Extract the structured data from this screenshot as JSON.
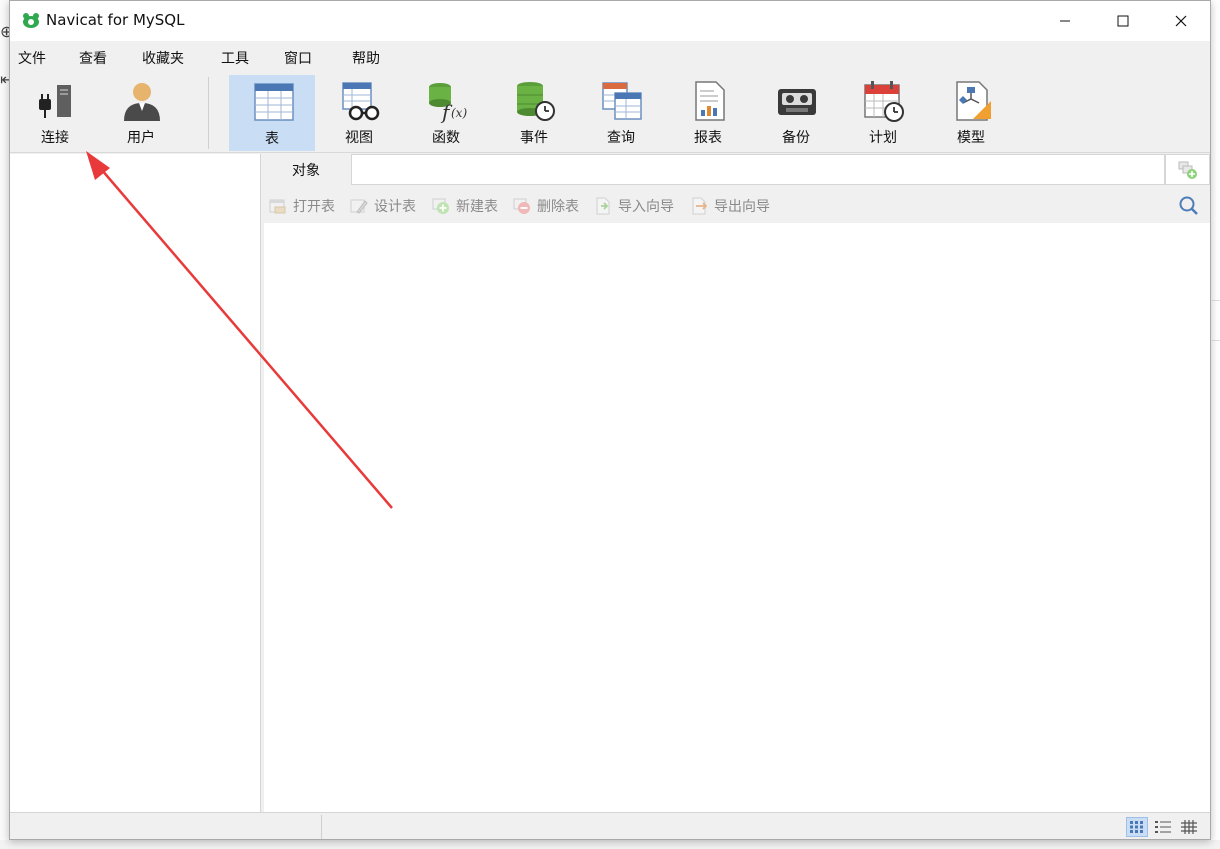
{
  "window": {
    "title": "Navicat for MySQL",
    "minimize_icon": "minimize-icon",
    "maximize_icon": "maximize-icon",
    "close_icon": "close-icon"
  },
  "menu": [
    "文件",
    "查看",
    "收藏夹",
    "工具",
    "窗口",
    "帮助"
  ],
  "toolbar": {
    "connect": "连接",
    "user": "用户",
    "table": "表",
    "view": "视图",
    "function": "函数",
    "event": "事件",
    "query": "查询",
    "report": "报表",
    "backup": "备份",
    "schedule": "计划",
    "model": "模型",
    "active": "表"
  },
  "object_tab": {
    "label": "对象"
  },
  "object_toolbar": {
    "open_table": "打开表",
    "design_table": "设计表",
    "new_table": "新建表",
    "delete_table": "删除表",
    "import_wizard": "导入向导",
    "export_wizard": "导出向导"
  },
  "status": {
    "views": [
      "list-view",
      "detail-view",
      "er-view"
    ],
    "active_view": "list-view"
  },
  "colors": {
    "accent": "#c9def5",
    "annotation_arrow": "#e83a3a",
    "logo_green": "#2fa84f"
  }
}
